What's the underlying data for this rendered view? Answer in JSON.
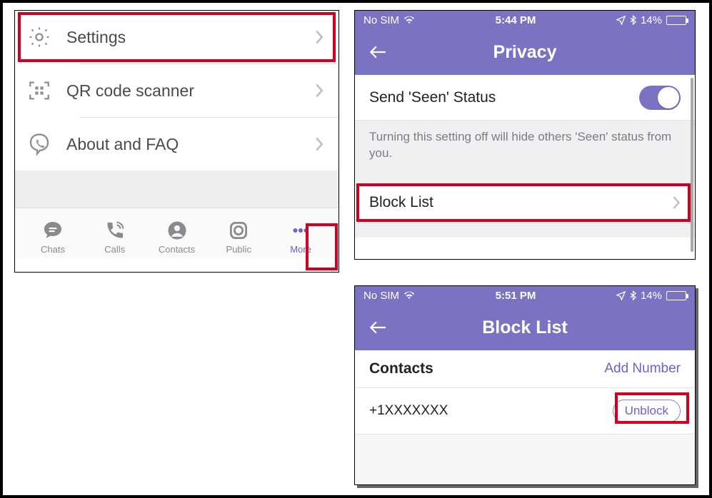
{
  "panel1": {
    "menu": {
      "settings": "Settings",
      "qr": "QR code scanner",
      "about": "About and FAQ"
    },
    "tabs": {
      "chats": "Chats",
      "calls": "Calls",
      "contacts": "Contacts",
      "public": "Public",
      "more": "More"
    }
  },
  "panel2": {
    "status": {
      "carrier": "No SIM",
      "time": "5:44 PM",
      "battery": "14%"
    },
    "title": "Privacy",
    "seen_label": "Send 'Seen' Status",
    "seen_desc": "Turning this setting off will hide others 'Seen' status from you.",
    "blocklist_label": "Block List"
  },
  "panel3": {
    "status": {
      "carrier": "No SIM",
      "time": "5:51 PM",
      "battery": "14%"
    },
    "title": "Block List",
    "section": "Contacts",
    "add": "Add Number",
    "contact": "+1XXXXXXX",
    "unblock": "Unblock"
  }
}
